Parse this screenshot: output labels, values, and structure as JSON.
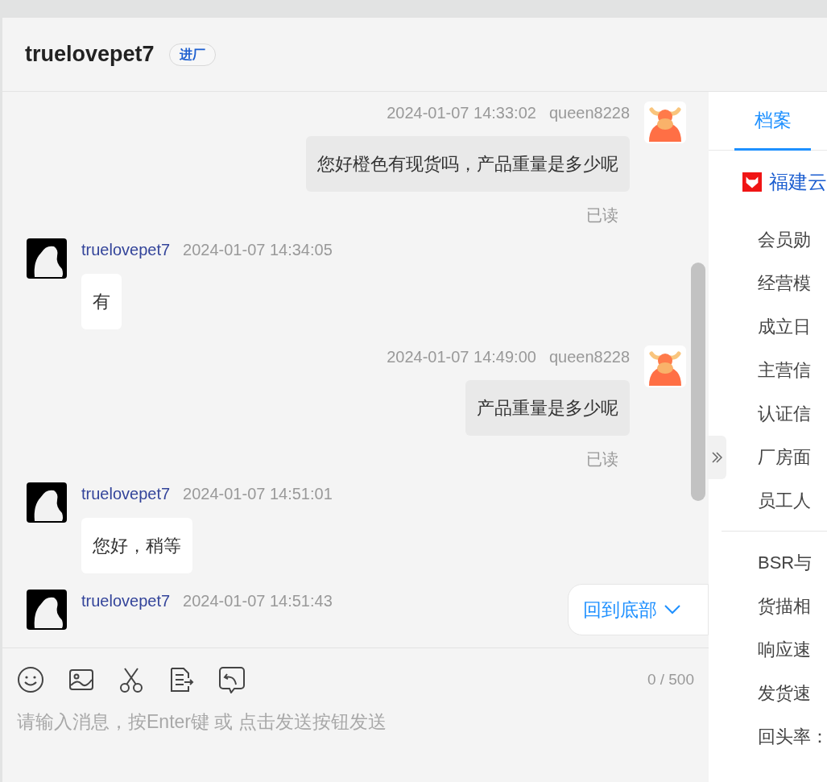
{
  "header": {
    "title": "truelovepet7",
    "badge": "进厂"
  },
  "messages": [
    {
      "kind": "sent",
      "sender": "queen8228",
      "time": "2024-01-07 14:33:02",
      "text": "您好橙色有现货吗，产品重量是多少呢",
      "receipt": "已读"
    },
    {
      "kind": "received",
      "sender": "truelovepet7",
      "time": "2024-01-07 14:34:05",
      "text": "有"
    },
    {
      "kind": "sent",
      "sender": "queen8228",
      "time": "2024-01-07 14:49:00",
      "text": "产品重量是多少呢",
      "receipt": "已读"
    },
    {
      "kind": "received",
      "sender": "truelovepet7",
      "time": "2024-01-07 14:51:01",
      "text": "您好，稍等"
    },
    {
      "kind": "received",
      "sender": "truelovepet7",
      "time": "2024-01-07 14:51:43"
    }
  ],
  "back_to_bottom": "回到底部",
  "composer": {
    "counter": "0 / 500",
    "placeholder": "请输入消息，按Enter键 或 点击发送按钮发送"
  },
  "side_panel": {
    "tabs": [
      {
        "label": "档案",
        "selected": true
      }
    ],
    "company": "福建云",
    "items": [
      {
        "label": "会员勋"
      },
      {
        "label": "经营模"
      },
      {
        "label": "成立日"
      },
      {
        "label": "主营信"
      },
      {
        "label": "认证信"
      },
      {
        "label": "厂房面"
      },
      {
        "label": "员工人"
      }
    ],
    "scores": [
      {
        "label": "BSR与"
      },
      {
        "label": "货描相"
      },
      {
        "label": "响应速"
      },
      {
        "label": "发货速"
      },
      {
        "label": "回头率："
      }
    ]
  }
}
